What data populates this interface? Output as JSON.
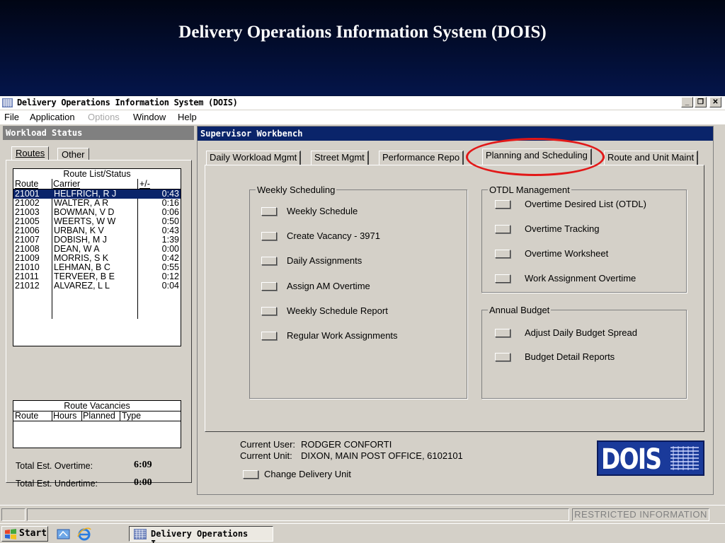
{
  "slide": {
    "title": "Delivery Operations Information System (DOIS)"
  },
  "window": {
    "title": "Delivery Operations Information System (DOIS)",
    "controls": {
      "minimize": "_",
      "restore": "❐",
      "close": "✕"
    }
  },
  "menu": {
    "file": "File",
    "application": "Application",
    "options": "Options",
    "window": "Window",
    "help": "Help"
  },
  "workload": {
    "header": "Workload Status",
    "tabs": {
      "routes": "Routes",
      "other": "Other"
    },
    "route_list": {
      "caption": "Route List/Status",
      "columns": [
        "Route",
        "Carrier",
        "+/-"
      ],
      "rows": [
        {
          "route": "21001",
          "carrier": "HELFRICH, R J",
          "diff": "0:43"
        },
        {
          "route": "21002",
          "carrier": "WALTER, A R",
          "diff": "0:16"
        },
        {
          "route": "21003",
          "carrier": "BOWMAN, V D",
          "diff": "0:06"
        },
        {
          "route": "21005",
          "carrier": "WEERTS, W W",
          "diff": "0:50"
        },
        {
          "route": "21006",
          "carrier": "URBAN, K V",
          "diff": "0:43"
        },
        {
          "route": "21007",
          "carrier": "DOBISH, M J",
          "diff": "1:39"
        },
        {
          "route": "21008",
          "carrier": "DEAN, W A",
          "diff": "0:00"
        },
        {
          "route": "21009",
          "carrier": "MORRIS, S K",
          "diff": "0:42"
        },
        {
          "route": "21010",
          "carrier": "LEHMAN, B C",
          "diff": "0:55"
        },
        {
          "route": "21011",
          "carrier": "TERVEER, B E",
          "diff": "0:12"
        },
        {
          "route": "21012",
          "carrier": "ALVAREZ, L L",
          "diff": "0:04"
        }
      ]
    },
    "total_overtime_label": "Total Est. Overtime:",
    "total_overtime_value": "6:09",
    "total_undertime_label": "Total Est. Undertime:",
    "total_undertime_value": "0:00",
    "vacancies": {
      "caption": "Route Vacancies",
      "columns": [
        "Route",
        "Hours",
        "Planned",
        "Type"
      ]
    }
  },
  "workbench": {
    "header": "Supervisor Workbench",
    "tabs": {
      "daily": "Daily Workload Mgmt",
      "street": "Street Mgmt",
      "performance": "Performance Repo",
      "planning": "Planning and Scheduling",
      "route_unit": "Route and Unit Maint"
    },
    "weekly_scheduling": {
      "title": "Weekly Scheduling",
      "items": [
        "Weekly Schedule",
        "Create Vacancy - 3971",
        "Daily Assignments",
        "Assign AM Overtime",
        "Weekly Schedule Report",
        "Regular Work Assignments"
      ]
    },
    "otdl": {
      "title": "OTDL Management",
      "items": [
        "Overtime Desired List (OTDL)",
        "Overtime Tracking",
        "Overtime Worksheet",
        "Work Assignment Overtime"
      ]
    },
    "budget": {
      "title": "Annual Budget",
      "items": [
        "Adjust Daily Budget Spread",
        "Budget Detail Reports"
      ]
    },
    "current_user_label": "Current User:",
    "current_user": "RODGER CONFORTI",
    "current_unit_label": "Current Unit:",
    "current_unit": "DIXON, MAIN POST OFFICE, 6102101",
    "change_unit": "Change Delivery Unit",
    "logo": "DOIS"
  },
  "status": {
    "restricted": "RESTRICTED INFORMATION"
  },
  "taskbar": {
    "start": "Start",
    "task": "Delivery Operations I..."
  },
  "colors": {
    "selection": "#0a246a",
    "highlight": "#e21818",
    "face": "#d4d0c8"
  }
}
